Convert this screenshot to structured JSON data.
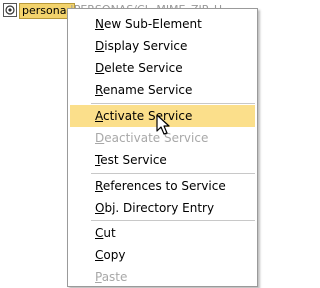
{
  "tree": {
    "node_label": "personas",
    "node_description": "|PERSONAS/CL_MIME_ZIP_H"
  },
  "context_menu": {
    "items": [
      {
        "label": "New Sub-Element",
        "underline": "N",
        "disabled": false
      },
      {
        "label": "Display Service",
        "underline": "D",
        "disabled": false
      },
      {
        "label": "Delete Service",
        "underline": "D",
        "disabled": false
      },
      {
        "label": "Rename Service",
        "underline": "R",
        "disabled": false
      },
      {
        "label": "Activate Service",
        "underline": "A",
        "disabled": false,
        "hover": true
      },
      {
        "label": "Deactivate Service",
        "underline": "D",
        "disabled": true
      },
      {
        "label": "Test Service",
        "underline": "T",
        "disabled": false
      },
      {
        "label": "References to Service",
        "underline": "R",
        "disabled": false
      },
      {
        "label": "Obj. Directory Entry",
        "underline": "O",
        "disabled": false
      },
      {
        "label": "Cut",
        "underline": "C",
        "disabled": false
      },
      {
        "label": "Copy",
        "underline": "C",
        "disabled": false
      },
      {
        "label": "Paste",
        "underline": "P",
        "disabled": true
      }
    ]
  },
  "colors": {
    "hover_bg": "#fbdf8b",
    "selected_node_bg": "#f3d36c",
    "disabled_text": "#a8a8a8"
  },
  "icons": {
    "node_icon": "service-node-icon",
    "cursor": "mouse-pointer-icon"
  }
}
